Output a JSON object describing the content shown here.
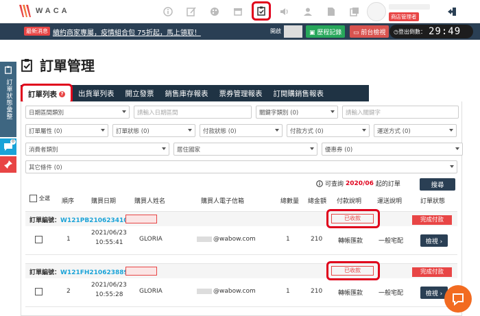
{
  "header": {
    "logo_text": "WACA",
    "user_role": "商店管理者",
    "icons": [
      "info-icon",
      "edit-icon",
      "palette-icon",
      "store-icon",
      "order-icon",
      "speaker-icon",
      "user-icon",
      "file-icon",
      "copy-icon"
    ]
  },
  "news": {
    "tag": "最新消息",
    "text": "續約商家專屬，疫情組合包 75折起，馬上領取！",
    "shop_label": "開啟",
    "history_btn": "歷程記錄",
    "front_btn": "前台檢視",
    "countdown_label": "登出倒數：",
    "countdown_time": "29:49"
  },
  "dock": {
    "label": "訂單狀態彙整",
    "msg_badge": "0"
  },
  "page": {
    "title": "訂單管理"
  },
  "tabs": [
    {
      "label": "訂單列表"
    },
    {
      "label": "出貨單列表"
    },
    {
      "label": "開立發票"
    },
    {
      "label": "銷售庫存報表"
    },
    {
      "label": "票券管理報表"
    },
    {
      "label": "訂閱購銷售報表"
    }
  ],
  "filters": {
    "date_type": "日期區間類別",
    "date_placeholder": "請輸入日期區間",
    "keyword_type": "關鍵字類別 (0)",
    "keyword_placeholder": "請輸入關鍵字",
    "order_attr": "訂單屬性 (0)",
    "order_status": "訂單狀態 (0)",
    "pay_status": "付款狀態 (0)",
    "pay_method": "付款方式 (0)",
    "ship_method": "運送方式 (0)",
    "ship_status": "運送狀態 (0)",
    "consumer_type": "消費者類別",
    "country": "居住國家",
    "coupon": "優惠券 (0)",
    "other": "其它條件 (0)"
  },
  "query": {
    "prefix": "可查詢",
    "date": "2020/06",
    "suffix": "起的訂單",
    "search_btn": "搜尋"
  },
  "columns": [
    "全選",
    "順序",
    "購買日期",
    "購買人姓名",
    "購買人電子信箱",
    "總數量",
    "總金額",
    "付款說明",
    "運送說明",
    "訂單狀態"
  ],
  "orders": [
    {
      "no_label": "訂單編號：",
      "no": "W121PB2106234102",
      "paid": "已收款",
      "status": "完成付款",
      "seq": "1",
      "date": "2021/06/23",
      "time": "10:55:41",
      "name": "GLORIA",
      "email": "@wabow.com",
      "qty": "1",
      "amount": "210",
      "pay": "轉帳匯款",
      "ship": "一般宅配",
      "view": "檢視 ›"
    },
    {
      "no_label": "訂單編號：",
      "no": "W121FH2106238896",
      "paid": "已收款",
      "status": "完成付款",
      "seq": "2",
      "date": "2021/06/23",
      "time": "10:55:28",
      "name": "GLORIA",
      "email": "@wabow.com",
      "qty": "1",
      "amount": "210",
      "pay": "轉帳匯款",
      "ship": "一般宅配",
      "view": "檢視 ›"
    }
  ]
}
